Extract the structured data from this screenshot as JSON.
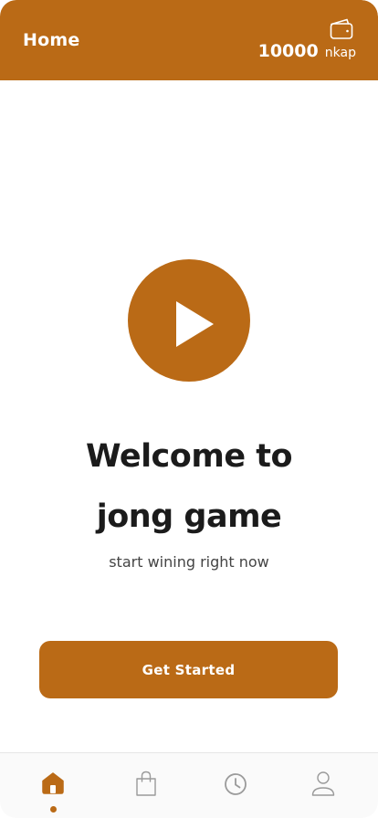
{
  "header": {
    "title": "Home",
    "balance_amount": "10000",
    "balance_unit": "nkap",
    "wallet_icon": "wallet-icon"
  },
  "main": {
    "play_icon": "play-icon",
    "welcome_line_1": "Welcome to",
    "welcome_line_2": "jong game",
    "subtitle": "start wining right now",
    "cta_label": "Get Started"
  },
  "bottom_nav": {
    "items": [
      {
        "icon": "home-icon",
        "active": true
      },
      {
        "icon": "shopping-bag-icon",
        "active": false
      },
      {
        "icon": "clock-icon",
        "active": false
      },
      {
        "icon": "user-icon",
        "active": false
      }
    ]
  },
  "colors": {
    "accent": "#BA6A16",
    "text_dark": "#1b1b1b",
    "text_muted": "#444444",
    "nav_icon": "#9a9a9a",
    "background": "#ffffff"
  }
}
